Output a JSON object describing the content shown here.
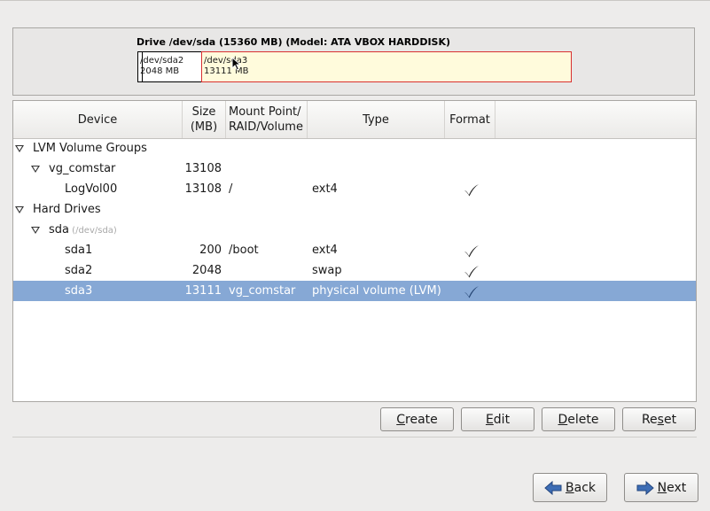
{
  "drive": {
    "title": "Drive /dev/sda (15360 MB) (Model: ATA VBOX HARDDISK)",
    "segments": [
      {
        "name": "/dev/sda2",
        "size": "2048 MB"
      },
      {
        "name": "/dev/sda3",
        "size": "13111 MB"
      }
    ]
  },
  "table": {
    "columns": {
      "device": "Device",
      "size": "Size\n(MB)",
      "mount": "Mount Point/\nRAID/Volume",
      "type": "Type",
      "format": "Format"
    },
    "rows": [
      {
        "device": "LVM Volume Groups",
        "size": "",
        "mount": "",
        "type": "",
        "format": false,
        "level": 0,
        "expander": true
      },
      {
        "device": "vg_comstar",
        "size": "13108",
        "mount": "",
        "type": "",
        "format": false,
        "level": 1,
        "expander": true
      },
      {
        "device": "LogVol00",
        "size": "13108",
        "mount": "/",
        "type": "ext4",
        "format": true,
        "level": 2,
        "expander": false
      },
      {
        "device": "Hard Drives",
        "size": "",
        "mount": "",
        "type": "",
        "format": false,
        "level": 0,
        "expander": true
      },
      {
        "device": "sda",
        "hint": "(/dev/sda)",
        "size": "",
        "mount": "",
        "type": "",
        "format": false,
        "level": 1,
        "expander": true
      },
      {
        "device": "sda1",
        "size": "200",
        "mount": "/boot",
        "type": "ext4",
        "format": true,
        "level": 2,
        "expander": false
      },
      {
        "device": "sda2",
        "size": "2048",
        "mount": "",
        "type": "swap",
        "format": true,
        "level": 2,
        "expander": false
      },
      {
        "device": "sda3",
        "size": "13111",
        "mount": "vg_comstar",
        "type": "physical volume (LVM)",
        "format": true,
        "level": 2,
        "expander": false,
        "selected": true
      }
    ]
  },
  "buttons": {
    "create": {
      "label": "Create",
      "mnemonic": "C"
    },
    "edit": {
      "label": "Edit",
      "mnemonic": "E"
    },
    "delete": {
      "label": "Delete",
      "mnemonic": "D"
    },
    "reset": {
      "label": "Reset",
      "mnemonic": "s"
    },
    "back": {
      "label": "Back",
      "mnemonic": "B"
    },
    "next": {
      "label": "Next",
      "mnemonic": "N"
    }
  },
  "colors": {
    "selection": "#86a8d5",
    "sda3_fill": "#fffbdc",
    "sda3_border": "#d93030",
    "nav_arrow": "#3d6db5"
  }
}
